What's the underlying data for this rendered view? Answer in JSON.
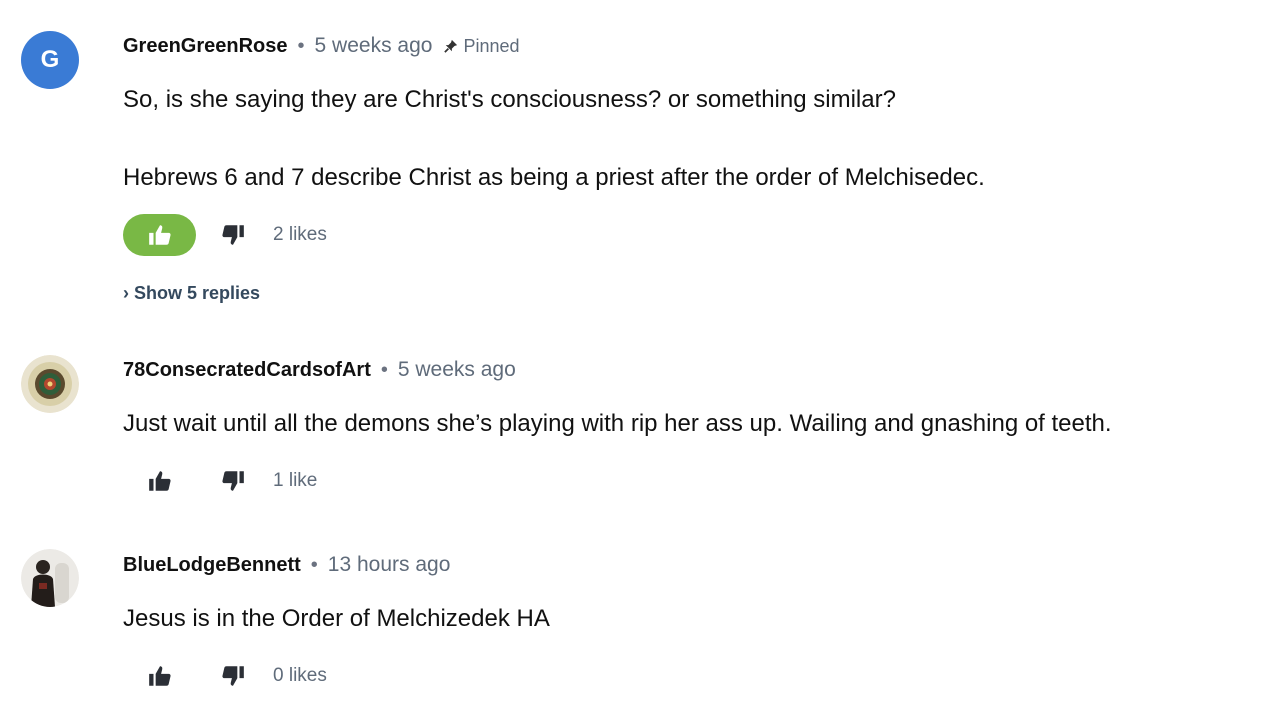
{
  "comments": [
    {
      "avatar_letter": "G",
      "author": "GreenGreenRose",
      "separator": "•",
      "time": "5 weeks ago",
      "pinned_label": "Pinned",
      "lines": [
        "So, is she saying they are Christ's consciousness? or something similar?",
        "Hebrews 6 and 7 describe Christ as being a priest after the order of Melchisedec."
      ],
      "likes": "2 likes",
      "liked": true,
      "replies_label": "› Show 5 replies",
      "like_icon": "thumbs-up-icon",
      "dislike_icon": "thumbs-down-icon"
    },
    {
      "author": "78ConsecratedCardsofArt",
      "separator": "•",
      "time": "5 weeks ago",
      "lines": [
        "Just wait until all the demons she’s playing with rip her ass up. Wailing and gnashing of teeth."
      ],
      "likes": "1 like",
      "liked": false
    },
    {
      "author": "BlueLodgeBennett",
      "separator": "•",
      "time": "13 hours ago",
      "lines": [
        "Jesus is in the Order of Melchizedek HA"
      ],
      "likes": "0 likes",
      "liked": false
    }
  ],
  "colors": {
    "like_active": "#79b845",
    "avatar_blue": "#3a7bd5",
    "muted_text": "#5f6b7a"
  }
}
